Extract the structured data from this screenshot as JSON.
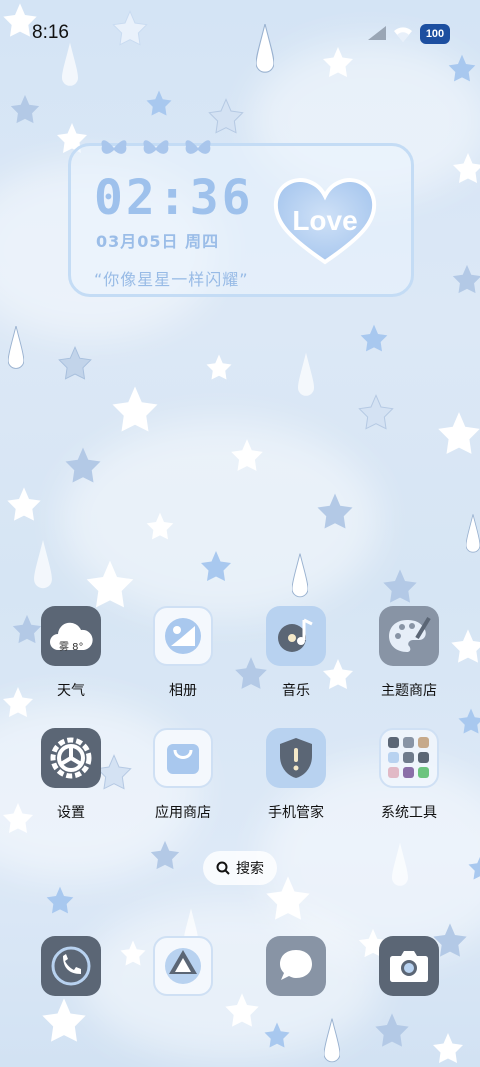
{
  "status": {
    "time": "8:16",
    "battery": "100"
  },
  "widget": {
    "clock": "02:36",
    "date": "03月05日 周四",
    "quote": "“你像星星一样闪耀”",
    "heart_text": "Love"
  },
  "apps_row1": [
    {
      "label": "天气",
      "icon": "weather-icon",
      "badge": "雾 8°"
    },
    {
      "label": "相册",
      "icon": "gallery-icon"
    },
    {
      "label": "音乐",
      "icon": "music-icon"
    },
    {
      "label": "主题商店",
      "icon": "theme-store-icon"
    }
  ],
  "apps_row2": [
    {
      "label": "设置",
      "icon": "settings-icon"
    },
    {
      "label": "应用商店",
      "icon": "app-store-icon"
    },
    {
      "label": "手机管家",
      "icon": "phone-manager-icon"
    },
    {
      "label": "系统工具",
      "icon": "system-tools-folder-icon"
    }
  ],
  "search": {
    "label": "搜索"
  },
  "dock": [
    {
      "icon": "phone-icon"
    },
    {
      "icon": "browser-icon"
    },
    {
      "icon": "messages-icon"
    },
    {
      "icon": "camera-icon"
    }
  ],
  "colors": {
    "accent": "#9ec1ec",
    "dark_icon": "#5b6675",
    "light_bg": "#d4e4f5"
  }
}
